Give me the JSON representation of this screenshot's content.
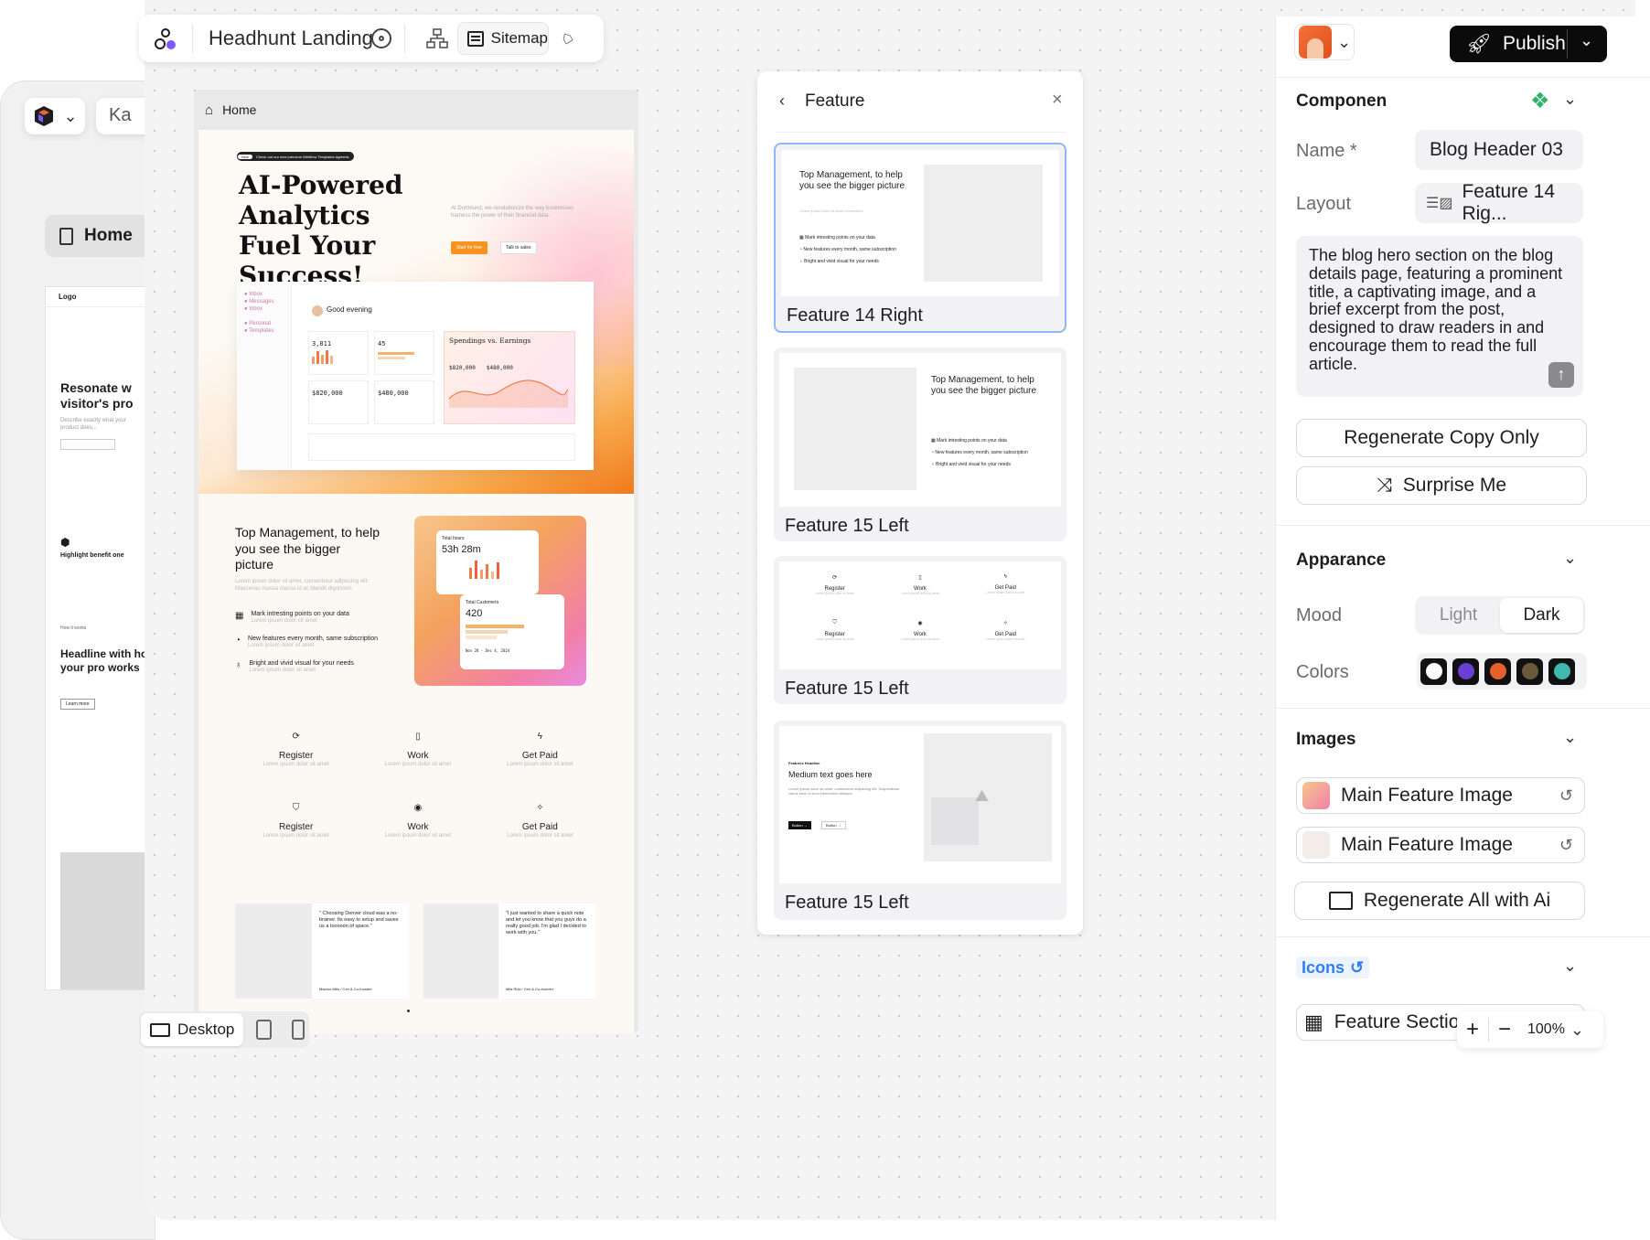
{
  "bg": {
    "home": "Home",
    "ka": "Ka",
    "logo": "Logo",
    "headline1": "Resonate w visitor's pro",
    "headline2_pre": "How it works",
    "headline2": "Headline with how your pro works",
    "benefit": "Highlight benefit one",
    "learn": "Learn more"
  },
  "toolbar": {
    "project_title": "Headhunt Landing",
    "sitemap_label": "Sitemap"
  },
  "breadcrumb": {
    "home_label": "Home"
  },
  "preview": {
    "announce": "Check out our new premium Webflow Templates Agreeds",
    "announce_badge": "New",
    "hero_title": "AI-Powered Analytics Fuel Your Success!",
    "hero_sub": "At Dortmund, we revolutionize the way businesses harness the power of their financial data.",
    "cta_primary": "Start for free",
    "cta_secondary": "Talk to sales",
    "dash_greeting": "Good evening",
    "dash_chart_title": "Spendings vs. Earnings",
    "dash_v1": "3,811",
    "dash_v2": "45",
    "dash_v3": "$820,000",
    "dash_v4": "$480,000",
    "dash_v5": "$820,000",
    "dash_v6": "$480,000",
    "feature_title": "Top Management, to help you see the bigger picture",
    "feature_items": [
      "Mark intresting points on your data",
      "New features every month, same subscription",
      "Bright and vivid visual for your needs"
    ],
    "hours_label": "Total hours",
    "hours_value": "53h 28m",
    "customers_label": "Total Customers",
    "customers_value": "420",
    "date_range": "Nov 28 - Dec 4, 2024",
    "steps": [
      "Register",
      "Work",
      "Get Paid",
      "Register",
      "Work",
      "Get Paid"
    ],
    "testimonial1": "\" Choosing Denver cloud was a no-brainer. Its easy to setup and saves us a tooooon of space.\"",
    "testimonial1_author": "Marcus Mills / Ceo & Co-founder",
    "testimonial2": "\"I just wanted to share a quick note and let you know that you guys do a really good job. I'm glad I decided to work with you.\"",
    "testimonial2_author": "Mila Ruiz / Ceo & Co-founder"
  },
  "viewbar": {
    "desktop_label": "Desktop"
  },
  "feature_panel": {
    "title": "Feature",
    "mini_title": "Top Management, to help you see the bigger picture",
    "mini_items": [
      "Mark intresting points on your data",
      "New features every month, same subscription",
      "Bright and vivid visual for your needs"
    ],
    "cards": [
      {
        "name": "Feature 14 Right"
      },
      {
        "name": "Feature 15 Left"
      },
      {
        "name": "Feature 15 Left"
      },
      {
        "name": "Feature 15 Left"
      }
    ],
    "steps": [
      "Register",
      "Work",
      "Get Paid",
      "Register",
      "Work",
      "Get Paid"
    ],
    "card4_eyebrow": "Features Headline",
    "card4_heading": "Medium text goes here",
    "card4_btn1": "Button →",
    "card4_btn2": "Button →"
  },
  "sidebar": {
    "publish_label": "Publish",
    "component_heading": "Componen",
    "name_label": "Name *",
    "name_value": "Blog Header 03",
    "layout_label": "Layout",
    "layout_value": "Feature 14 Rig...",
    "description": "The blog hero section on the blog details page, featuring a prominent title, a captivating image, and a brief excerpt from the post, designed to draw readers in and encourage them to read the full article.",
    "regenerate_copy": "Regenerate Copy Only",
    "surprise": "Surprise Me",
    "appearance_heading": "Apparance",
    "mood_label": "Mood",
    "mood_light": "Light",
    "mood_dark": "Dark",
    "colors_label": "Colors",
    "swatches": [
      "#ffffff",
      "#6a3fd4",
      "#e5602a",
      "#6b5a3a",
      "#3fb8ad"
    ],
    "images_heading": "Images",
    "images": [
      {
        "label": "Main Feature Image"
      },
      {
        "label": "Main Feature Image"
      }
    ],
    "regenerate_all": "Regenerate All with Ai",
    "icons_heading": "Icons",
    "feature_section": "Feature Section",
    "zoom": "100%"
  },
  "colors": {
    "accent_blue": "#2e7cf6",
    "publish_bg": "#0b0b0c",
    "selected_border": "#8fb6f5"
  }
}
